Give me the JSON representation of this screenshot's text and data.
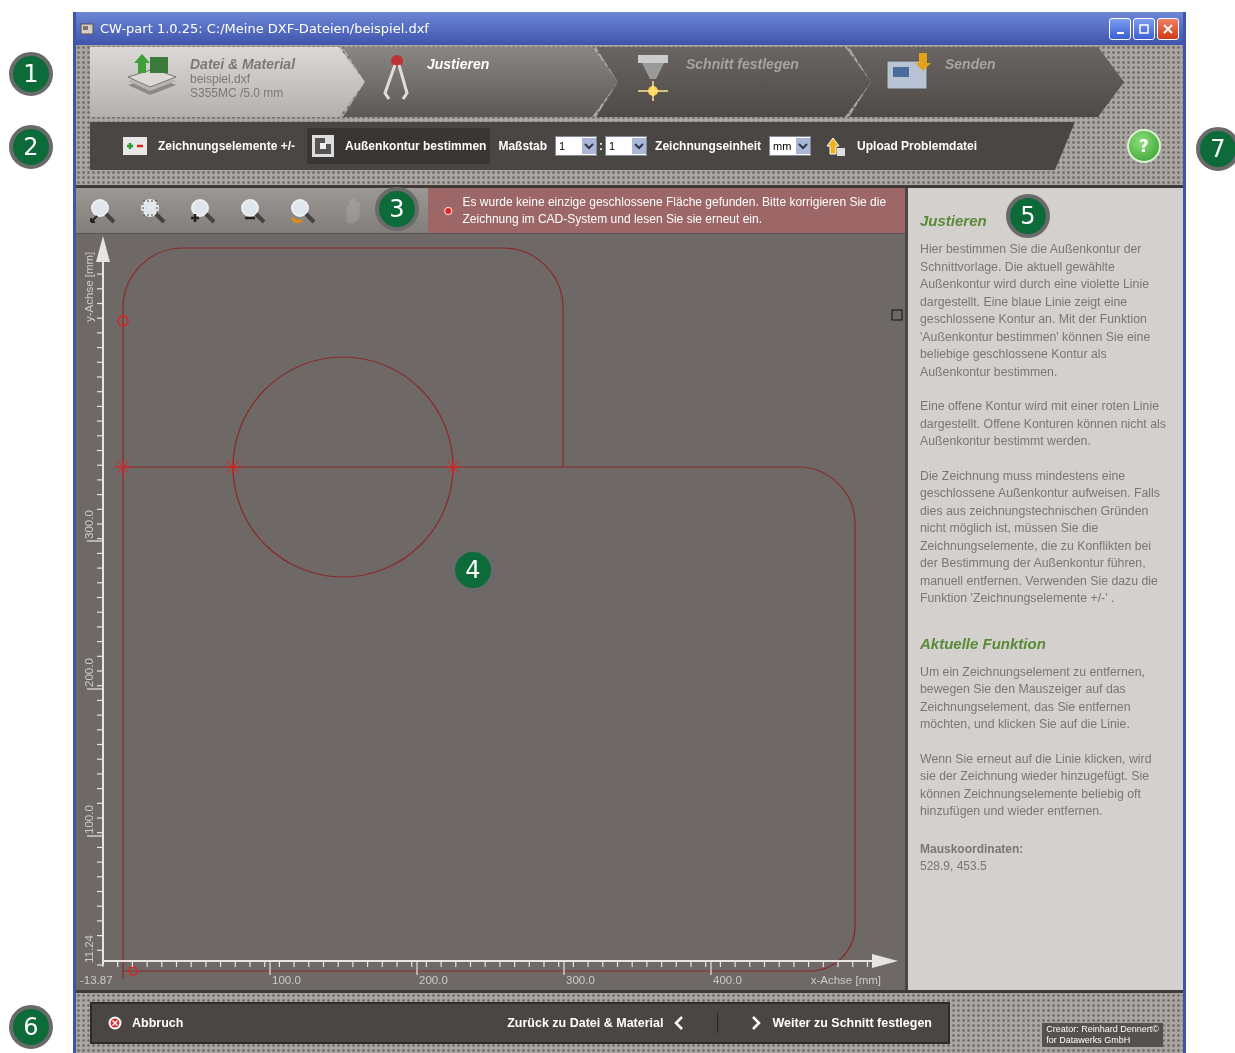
{
  "window": {
    "title": "CW-part 1.0.25: C:/Meine DXF-Dateien/beispiel.dxf"
  },
  "wizard_steps": [
    {
      "kind": "file",
      "title": "Datei & Material",
      "details": [
        "beispiel.dxf",
        "S355MC /5.0 mm"
      ],
      "selected": false,
      "disabled": false
    },
    {
      "kind": "adjust",
      "title": "Justieren",
      "selected": true,
      "disabled": false
    },
    {
      "kind": "cut",
      "title": "Schnitt festlegen",
      "selected": false,
      "disabled": true
    },
    {
      "kind": "send",
      "title": "Senden",
      "selected": false,
      "disabled": true
    }
  ],
  "toolbar": [
    {
      "kind": "button",
      "label": "Zeichnungselemente +/-"
    },
    {
      "kind": "button",
      "label": "Außenkontur bestimmen"
    },
    {
      "kind": "label",
      "label": "Maßstab"
    },
    {
      "kind": "select",
      "value": "1"
    },
    {
      "kind": "text",
      "label": ":"
    },
    {
      "kind": "select",
      "value": "1"
    },
    {
      "kind": "label",
      "label": "Zeichnungseinheit"
    },
    {
      "kind": "select",
      "value": "mm"
    },
    {
      "kind": "button",
      "label": "Upload Problemdatei"
    }
  ],
  "help_button": {
    "label": "?"
  },
  "view_tools": [
    {
      "kind": "zoom-all",
      "disabled": false
    },
    {
      "kind": "zoom-window",
      "disabled": false
    },
    {
      "kind": "zoom-in",
      "disabled": false
    },
    {
      "kind": "zoom-out",
      "disabled": false
    },
    {
      "kind": "zoom-back",
      "disabled": false
    },
    {
      "kind": "pan",
      "disabled": true
    }
  ],
  "message": {
    "text": "Es wurde keine einzige geschlossene Fläche gefunden. Bitte korrigieren Sie die Zeichnung im CAD-System und lesen Sie sie erneut ein."
  },
  "canvas": {
    "x_axis": {
      "title": "x-Achse [mm]",
      "labels": [
        "-13.87",
        "100.0",
        "200.0",
        "300.0",
        "400.0"
      ]
    },
    "y_axis": {
      "title": "y-Achse [mm]",
      "labels": [
        "11.24",
        "100.0",
        "200.0",
        "300.0"
      ]
    }
  },
  "help_panel": {
    "sections": [
      {
        "heading": "Justieren",
        "paragraphs": [
          "Hier bestimmen Sie die Außenkontur der Schnittvorlage. Die aktuell gewählte Außenkontur wird durch eine violette Linie dargestellt. Eine blaue Linie zeigt eine geschlossene Kontur an. Mit der Funktion 'Außenkontur bestimmen' können Sie eine beliebige geschlossene Kontur als Außenkontur bestimmen.",
          "Eine offene Kontur wird mit einer roten Linie dargestellt. Offene Konturen können nicht als Außenkontur bestimmt werden.",
          "Die Zeichnung muss mindestens eine geschlossene Außenkontur aufweisen. Falls dies aus zeichnungstechnischen Gründen nicht möglich ist, müssen Sie die Zeichnungselemente, die zu Konflikten bei der Bestimmung der Außenkontur führen, manuell entfernen. Verwenden Sie dazu die Funktion 'Zeichnungselemente +/-' ."
        ]
      },
      {
        "heading": "Aktuelle Funktion",
        "paragraphs": [
          "Um ein Zeichnungselement zu entfernen, bewegen Sie den Mauszeiger auf das Zeichnungselement, das Sie entfernen möchten, und klicken Sie auf die Linie.",
          "Wenn Sie erneut auf die Linie klicken, wird sie der Zeichnung wieder hinzugefügt. Sie können Zeichnungselemente beliebig oft hinzufügen und wieder entfernen."
        ]
      }
    ],
    "coordinates": {
      "label": "Mauskoordinaten:",
      "value": "528.9, 453.5"
    }
  },
  "footer": {
    "cancel": "Abbruch",
    "back": "Zurück zu Datei & Material",
    "next": "Weiter zu Schnitt festlegen",
    "credit": [
      "Creator: Reinhard Dennert©",
      "for Datawerks GmbH"
    ]
  },
  "callouts": [
    "1",
    "2",
    "3",
    "4",
    "5",
    "6",
    "7"
  ]
}
